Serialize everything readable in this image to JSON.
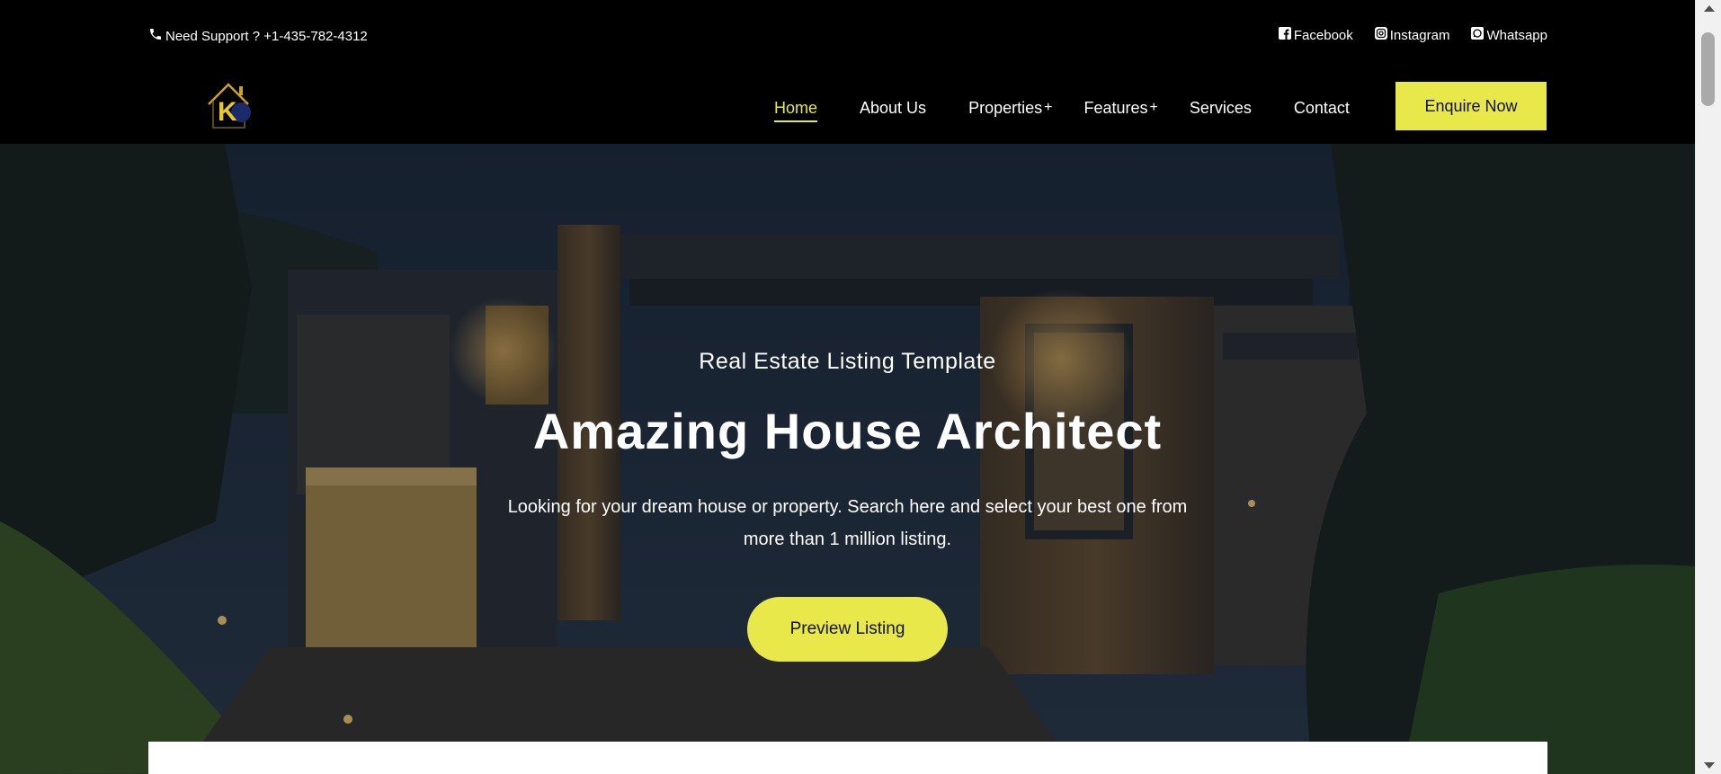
{
  "topbar": {
    "support_text": "Need Support ? +1-435-782-4312",
    "socials": [
      {
        "label": "Facebook",
        "icon": "facebook-icon"
      },
      {
        "label": "Instagram",
        "icon": "instagram-icon"
      },
      {
        "label": "Whatsapp",
        "icon": "whatsapp-icon"
      }
    ]
  },
  "nav": {
    "logo_letter": "K",
    "items": [
      {
        "label": "Home",
        "active": true
      },
      {
        "label": "About Us"
      },
      {
        "label": "Properties",
        "dropdown": "+"
      },
      {
        "label": "Features",
        "dropdown": "+"
      },
      {
        "label": "Services"
      },
      {
        "label": "Contact"
      }
    ],
    "cta": "Enquire Now"
  },
  "hero": {
    "eyebrow": "Real Estate Listing Template",
    "headline": "Amazing House Architect",
    "lead": "Looking for your dream house or property. Search here and select your best one from more than 1 million listing.",
    "button": "Preview Listing"
  },
  "colors": {
    "accent": "#e8e84a",
    "bar": "#000000"
  }
}
